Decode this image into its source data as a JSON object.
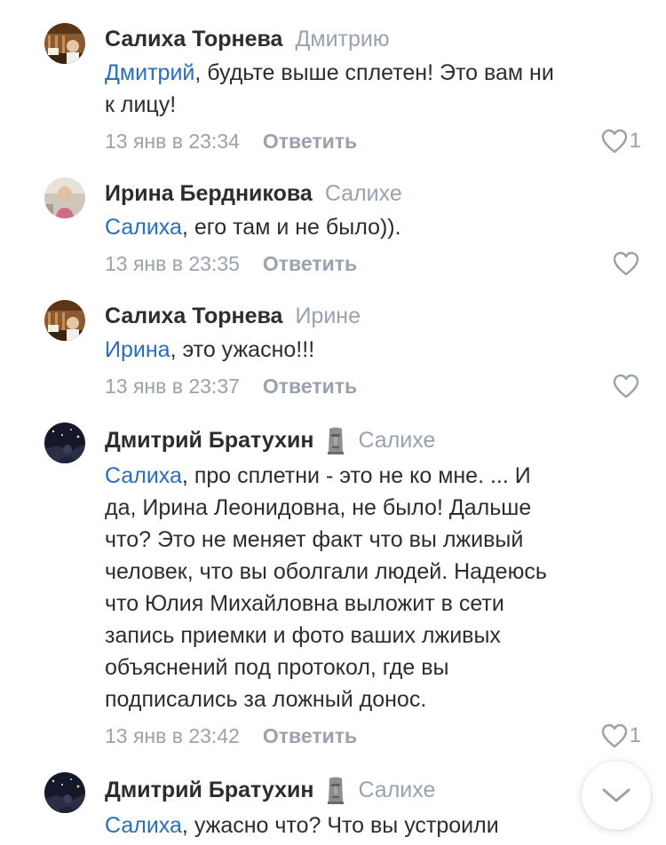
{
  "comments": [
    {
      "author": "Салиха Торнева",
      "reply_to": "Дмитрию",
      "mention": "Дмитрий",
      "text_lines": [
        ", будьте выше сплетен! Это вам ни",
        "к лицу!"
      ],
      "date": "13 янв в 23:34",
      "reply_label": "Ответить",
      "likes": "1"
    },
    {
      "author": "Ирина Бердникова",
      "reply_to": "Салихе",
      "mention": "Салиха",
      "text_lines": [
        ", его там и не было))."
      ],
      "date": "13 янв в 23:35",
      "reply_label": "Ответить",
      "likes": ""
    },
    {
      "author": "Салиха Торнева",
      "reply_to": "Ирине",
      "mention": "Ирина",
      "text_lines": [
        ", это ужасно!!!"
      ],
      "date": "13 янв в 23:37",
      "reply_label": "Ответить",
      "likes": ""
    },
    {
      "author": "Дмитрий Братухин",
      "author_emoji": "moai-emoji-icon",
      "reply_to": "Салихе",
      "mention": "Салиха",
      "text_lines": [
        ", про сплетни - это не ко мне. ... И",
        "да, Ирина Леонидовна, не было! Дальше",
        "что? Это не меняет факт что вы лживый",
        "человек,  что вы оболгали людей. Надеюсь",
        "что Юлия Михайловна выложит в сети",
        "запись приемки и фото ваших лживых",
        "объяснений под протокол, где вы",
        "подписались за ложный донос."
      ],
      "date": "13 янв в 23:42",
      "reply_label": "Ответить",
      "likes": "1"
    },
    {
      "author": "Дмитрий Братухин",
      "author_emoji": "moai-emoji-icon",
      "reply_to": "Салихе",
      "mention": "Салиха",
      "text_lines": [
        ", ужасно что? Что вы устроили"
      ],
      "date": "",
      "reply_label": "",
      "likes": ""
    }
  ],
  "icons": {
    "like": "heart-outline-icon",
    "scroll_down": "chevron-down-icon"
  },
  "colors": {
    "author": "#2c2d2e",
    "mention_link": "#2a6ebb",
    "secondary": "#99a2ad"
  }
}
